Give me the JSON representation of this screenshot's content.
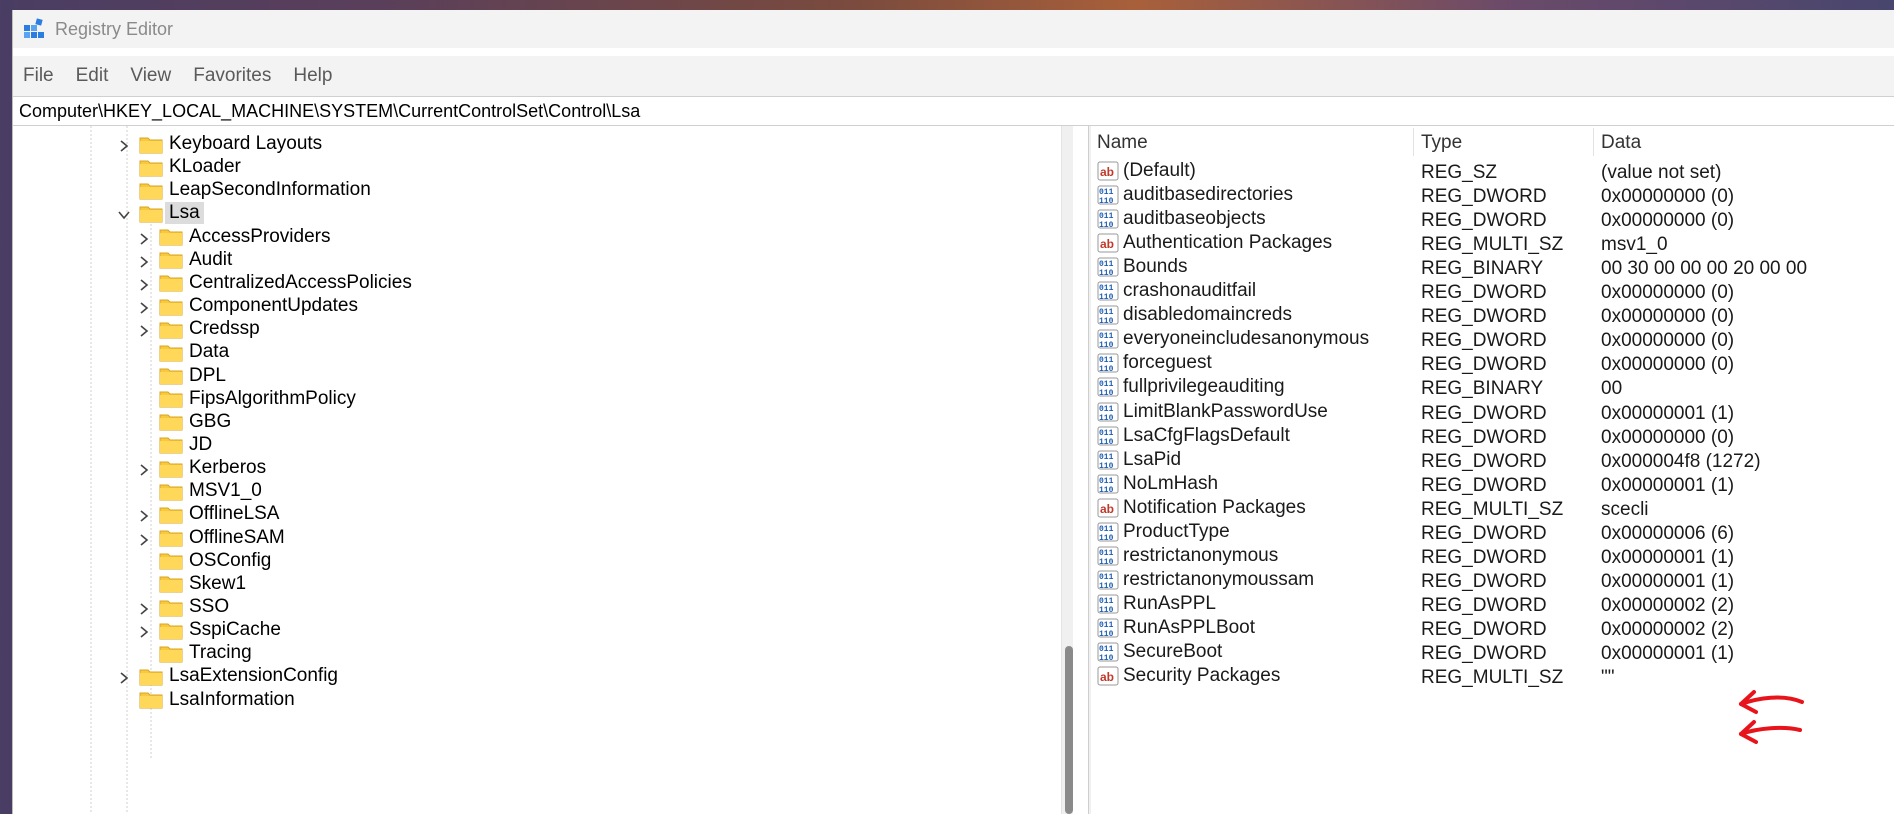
{
  "window": {
    "title": "Registry Editor"
  },
  "menu": [
    "File",
    "Edit",
    "View",
    "Favorites",
    "Help"
  ],
  "address": "Computer\\HKEY_LOCAL_MACHINE\\SYSTEM\\CurrentControlSet\\Control\\Lsa",
  "tree": [
    {
      "label": "Keyboard Layouts",
      "level": 1,
      "expander": "collapsed"
    },
    {
      "label": "KLoader",
      "level": 1,
      "expander": "none"
    },
    {
      "label": "LeapSecondInformation",
      "level": 1,
      "expander": "none"
    },
    {
      "label": "Lsa",
      "level": 1,
      "expander": "expanded",
      "selected": true
    },
    {
      "label": "AccessProviders",
      "level": 2,
      "expander": "collapsed"
    },
    {
      "label": "Audit",
      "level": 2,
      "expander": "collapsed"
    },
    {
      "label": "CentralizedAccessPolicies",
      "level": 2,
      "expander": "collapsed"
    },
    {
      "label": "ComponentUpdates",
      "level": 2,
      "expander": "collapsed"
    },
    {
      "label": "Credssp",
      "level": 2,
      "expander": "collapsed"
    },
    {
      "label": "Data",
      "level": 2,
      "expander": "none"
    },
    {
      "label": "DPL",
      "level": 2,
      "expander": "none"
    },
    {
      "label": "FipsAlgorithmPolicy",
      "level": 2,
      "expander": "none"
    },
    {
      "label": "GBG",
      "level": 2,
      "expander": "none"
    },
    {
      "label": "JD",
      "level": 2,
      "expander": "none"
    },
    {
      "label": "Kerberos",
      "level": 2,
      "expander": "collapsed"
    },
    {
      "label": "MSV1_0",
      "level": 2,
      "expander": "none"
    },
    {
      "label": "OfflineLSA",
      "level": 2,
      "expander": "collapsed"
    },
    {
      "label": "OfflineSAM",
      "level": 2,
      "expander": "collapsed"
    },
    {
      "label": "OSConfig",
      "level": 2,
      "expander": "none"
    },
    {
      "label": "Skew1",
      "level": 2,
      "expander": "none"
    },
    {
      "label": "SSO",
      "level": 2,
      "expander": "collapsed"
    },
    {
      "label": "SspiCache",
      "level": 2,
      "expander": "collapsed"
    },
    {
      "label": "Tracing",
      "level": 2,
      "expander": "none"
    },
    {
      "label": "LsaExtensionConfig",
      "level": 1,
      "expander": "collapsed"
    },
    {
      "label": "LsaInformation",
      "level": 1,
      "expander": "none"
    }
  ],
  "columns": {
    "name": "Name",
    "type": "Type",
    "data": "Data"
  },
  "values": [
    {
      "name": "(Default)",
      "type": "REG_SZ",
      "data": "(value not set)",
      "icon": "string-value-icon"
    },
    {
      "name": "auditbasedirectories",
      "type": "REG_DWORD",
      "data": "0x00000000 (0)",
      "icon": "binary-value-icon"
    },
    {
      "name": "auditbaseobjects",
      "type": "REG_DWORD",
      "data": "0x00000000 (0)",
      "icon": "binary-value-icon"
    },
    {
      "name": "Authentication Packages",
      "type": "REG_MULTI_SZ",
      "data": "msv1_0",
      "icon": "string-value-icon"
    },
    {
      "name": "Bounds",
      "type": "REG_BINARY",
      "data": "00 30 00 00 00 20 00 00",
      "icon": "binary-value-icon"
    },
    {
      "name": "crashonauditfail",
      "type": "REG_DWORD",
      "data": "0x00000000 (0)",
      "icon": "binary-value-icon"
    },
    {
      "name": "disabledomaincreds",
      "type": "REG_DWORD",
      "data": "0x00000000 (0)",
      "icon": "binary-value-icon"
    },
    {
      "name": "everyoneincludesanonymous",
      "type": "REG_DWORD",
      "data": "0x00000000 (0)",
      "icon": "binary-value-icon"
    },
    {
      "name": "forceguest",
      "type": "REG_DWORD",
      "data": "0x00000000 (0)",
      "icon": "binary-value-icon"
    },
    {
      "name": "fullprivilegeauditing",
      "type": "REG_BINARY",
      "data": "00",
      "icon": "binary-value-icon"
    },
    {
      "name": "LimitBlankPasswordUse",
      "type": "REG_DWORD",
      "data": "0x00000001 (1)",
      "icon": "binary-value-icon"
    },
    {
      "name": "LsaCfgFlagsDefault",
      "type": "REG_DWORD",
      "data": "0x00000000 (0)",
      "icon": "binary-value-icon"
    },
    {
      "name": "LsaPid",
      "type": "REG_DWORD",
      "data": "0x000004f8 (1272)",
      "icon": "binary-value-icon"
    },
    {
      "name": "NoLmHash",
      "type": "REG_DWORD",
      "data": "0x00000001 (1)",
      "icon": "binary-value-icon"
    },
    {
      "name": "Notification Packages",
      "type": "REG_MULTI_SZ",
      "data": "scecli",
      "icon": "string-value-icon"
    },
    {
      "name": "ProductType",
      "type": "REG_DWORD",
      "data": "0x00000006 (6)",
      "icon": "binary-value-icon"
    },
    {
      "name": "restrictanonymous",
      "type": "REG_DWORD",
      "data": "0x00000001 (1)",
      "icon": "binary-value-icon"
    },
    {
      "name": "restrictanonymoussam",
      "type": "REG_DWORD",
      "data": "0x00000001 (1)",
      "icon": "binary-value-icon"
    },
    {
      "name": "RunAsPPL",
      "type": "REG_DWORD",
      "data": "0x00000002 (2)",
      "icon": "binary-value-icon",
      "annotated": true
    },
    {
      "name": "RunAsPPLBoot",
      "type": "REG_DWORD",
      "data": "0x00000002 (2)",
      "icon": "binary-value-icon",
      "annotated": true
    },
    {
      "name": "SecureBoot",
      "type": "REG_DWORD",
      "data": "0x00000001 (1)",
      "icon": "binary-value-icon"
    },
    {
      "name": "Security Packages",
      "type": "REG_MULTI_SZ",
      "data": "\"\"",
      "icon": "string-value-icon"
    }
  ],
  "colors": {
    "folder": "#f8c93d",
    "annotation": "#e8141c",
    "selection": "#dcdcdc"
  }
}
